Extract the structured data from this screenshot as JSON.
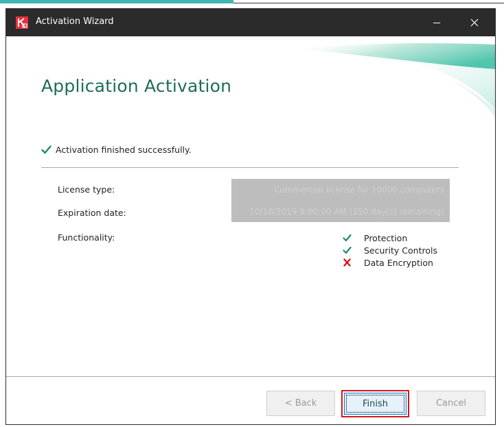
{
  "window": {
    "title": "Activation Wizard",
    "minimize_symbol": "—",
    "close_symbol": "✕"
  },
  "page": {
    "title": "Application Activation",
    "status_text": "Activation finished successfully."
  },
  "details": {
    "license_type_label": "License type:",
    "license_type_value": "Commercial license for 10000 computers",
    "expiration_label": "Expiration date:",
    "expiration_value": "10/18/2019 8:00:00 AM (150 day(s) remaining)",
    "functionality_label": "Functionality:"
  },
  "functionality": [
    {
      "label": "Protection",
      "status": "enabled",
      "icon": "check-icon"
    },
    {
      "label": "Security Controls",
      "status": "enabled",
      "icon": "check-icon"
    },
    {
      "label": "Data Encryption",
      "status": "disabled",
      "icon": "cross-icon"
    }
  ],
  "buttons": {
    "back": "< Back",
    "finish": "Finish",
    "cancel": "Cancel"
  },
  "colors": {
    "accent_teal": "#1f6b5c",
    "check_green": "#1a8a6a",
    "cross_red": "#d7141a",
    "highlight_red": "#d7141a",
    "titlebar": "#2b2b2b"
  }
}
